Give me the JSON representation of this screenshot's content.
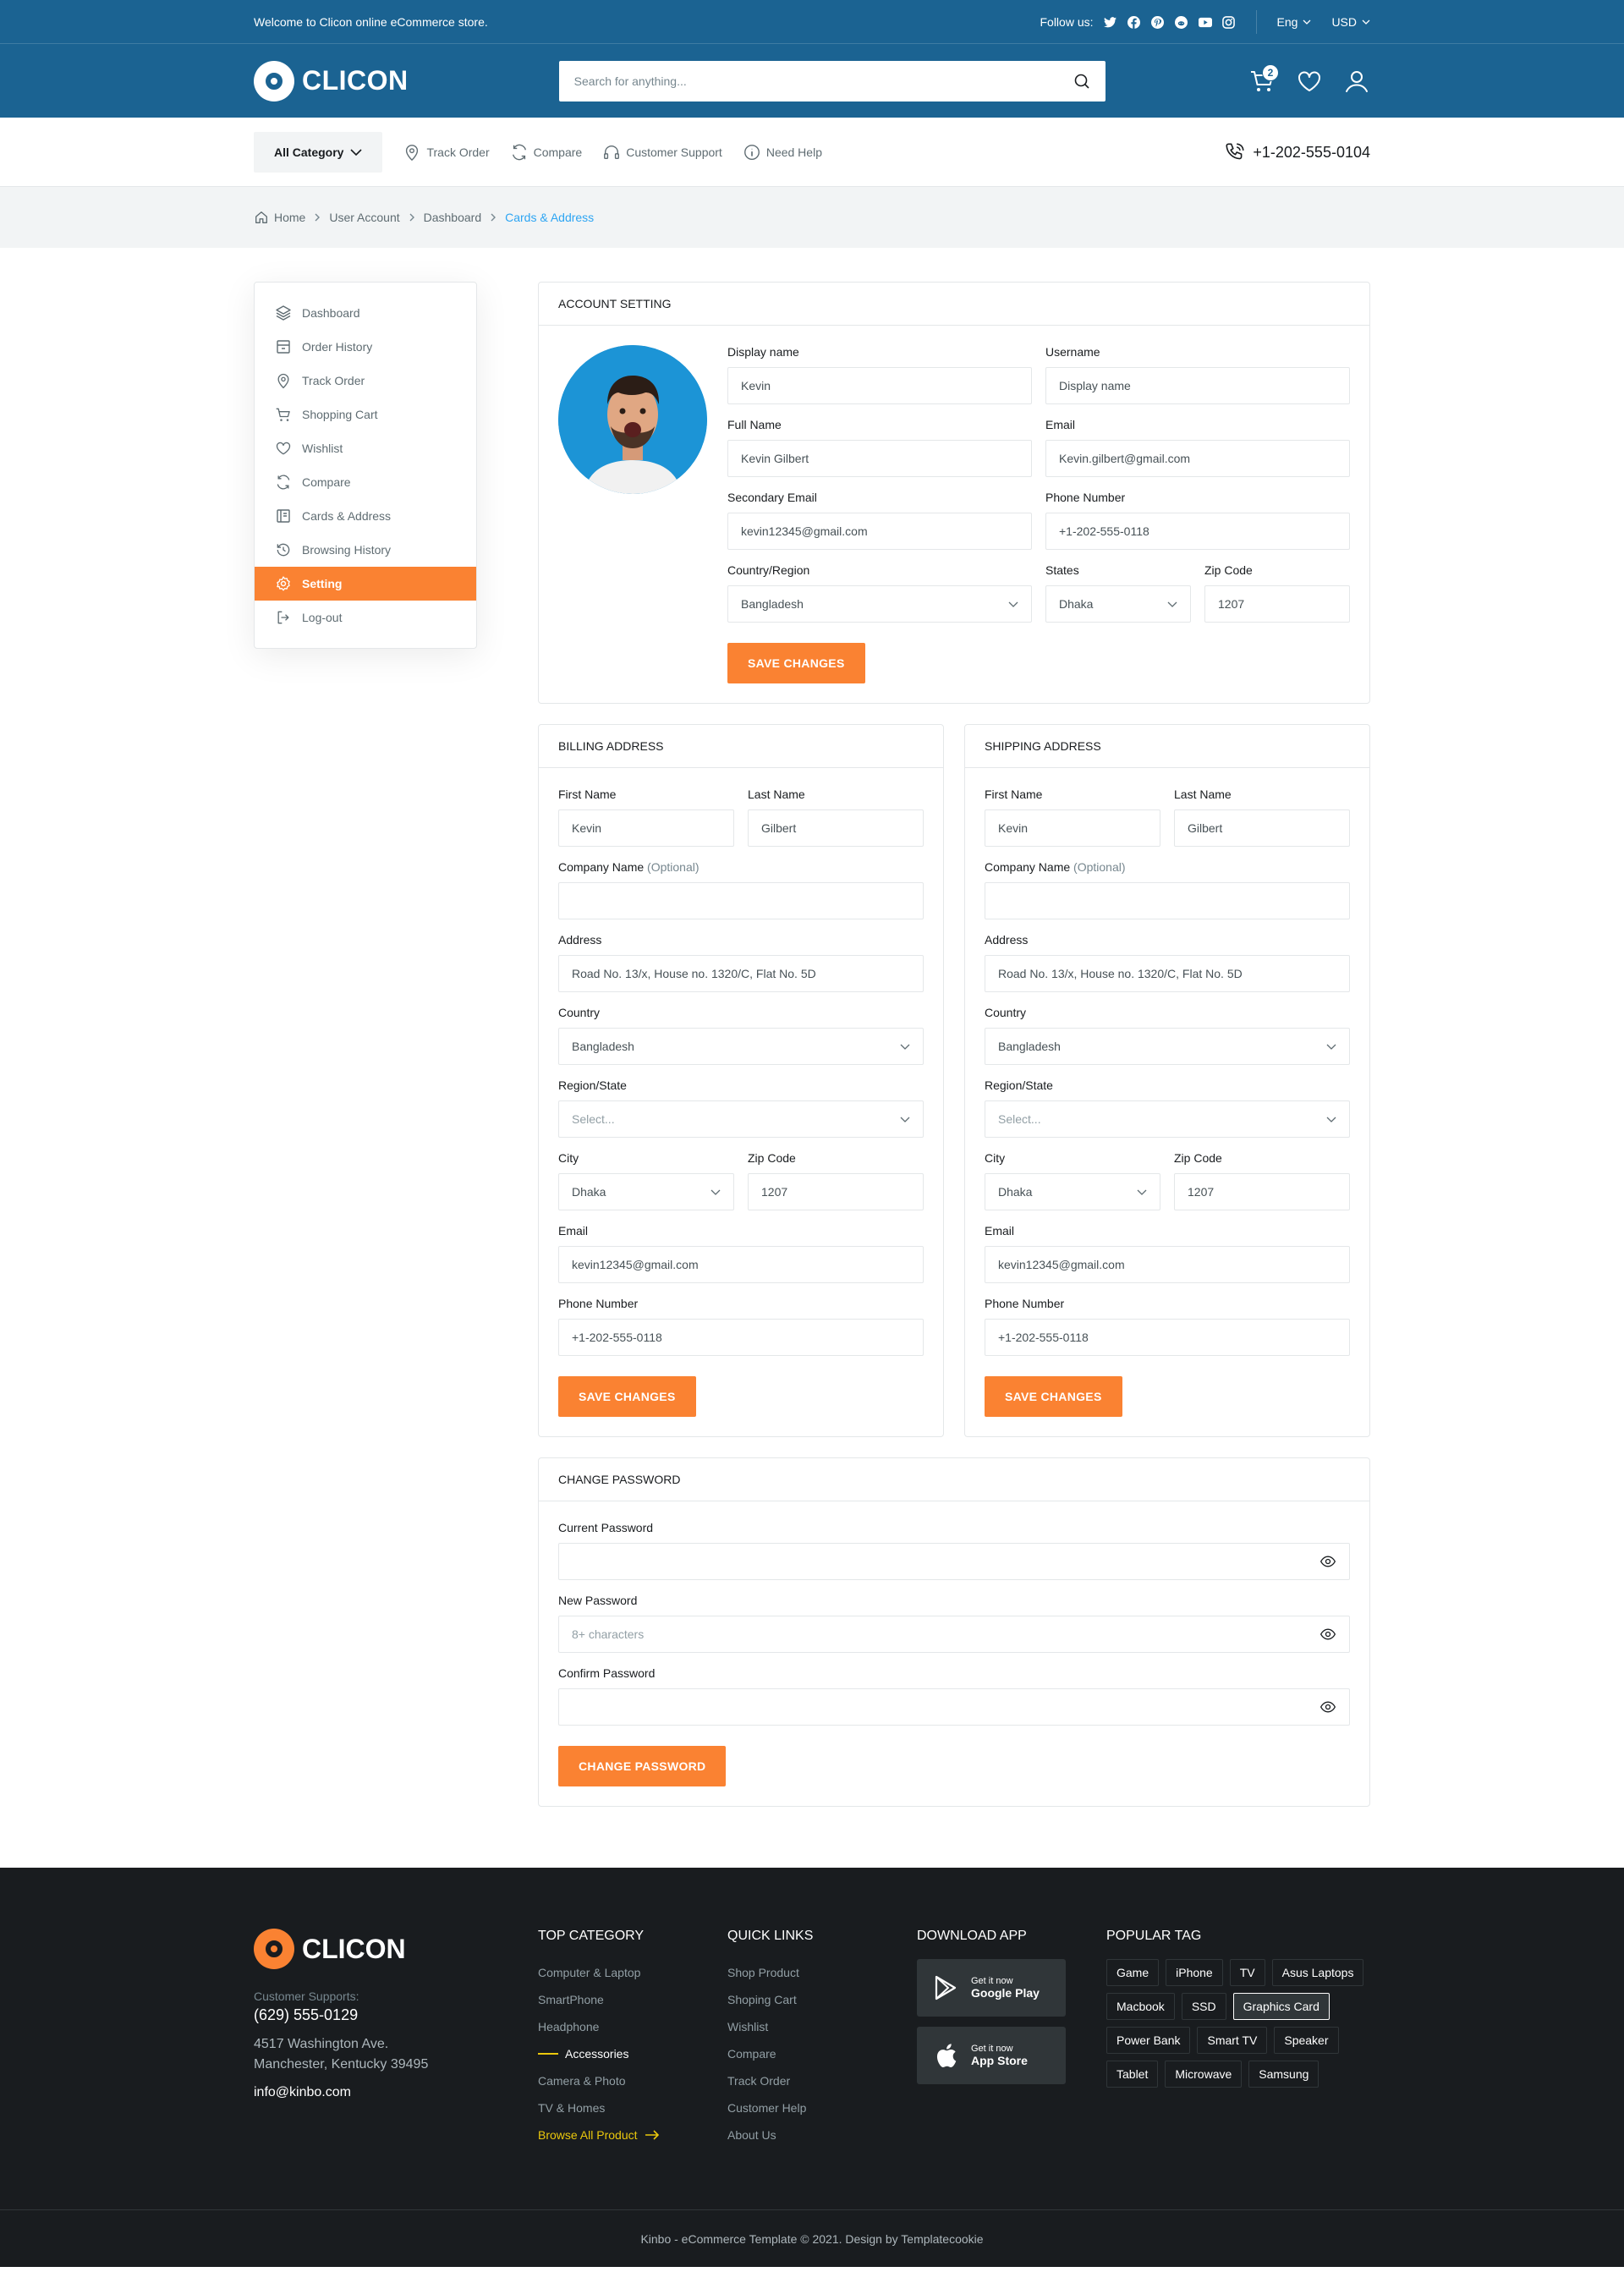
{
  "topbar": {
    "welcome": "Welcome to Clicon online eCommerce store.",
    "follow": "Follow us:",
    "lang": "Eng",
    "currency": "USD"
  },
  "header": {
    "brand": "CLICON",
    "search_placeholder": "Search for anything...",
    "cart_count": "2"
  },
  "nav": {
    "all_category": "All Category",
    "links": [
      "Track Order",
      "Compare",
      "Customer Support",
      "Need Help"
    ],
    "phone": "+1-202-555-0104"
  },
  "breadcrumb": [
    "Home",
    "User Account",
    "Dashboard",
    "Cards & Address"
  ],
  "sidebar": [
    "Dashboard",
    "Order History",
    "Track Order",
    "Shopping Cart",
    "Wishlist",
    "Compare",
    "Cards & Address",
    "Browsing History",
    "Setting",
    "Log-out"
  ],
  "account": {
    "title": "ACCOUNT SETTING",
    "display_name_label": "Display name",
    "display_name": "Kevin",
    "username_label": "Username",
    "username_placeholder": "Display name",
    "full_name_label": "Full Name",
    "full_name": "Kevin Gilbert",
    "email_label": "Email",
    "email": "Kevin.gilbert@gmail.com",
    "sec_email_label": "Secondary Email",
    "sec_email": "kevin12345@gmail.com",
    "phone_label": "Phone Number",
    "phone": "+1-202-555-0118",
    "country_label": "Country/Region",
    "country": "Bangladesh",
    "states_label": "States",
    "state": "Dhaka",
    "zip_label": "Zip Code",
    "zip": "1207",
    "save": "SAVE CHANGES"
  },
  "billing": {
    "title": "BILLING ADDRESS",
    "first_label": "First Name",
    "first": "Kevin",
    "last_label": "Last Name",
    "last": "Gilbert",
    "company_label": "Company Name",
    "optional": "(Optional)",
    "address_label": "Address",
    "address": "Road No. 13/x, House no. 1320/C, Flat No. 5D",
    "country_label": "Country",
    "country": "Bangladesh",
    "region_label": "Region/State",
    "region_placeholder": "Select...",
    "city_label": "City",
    "city": "Dhaka",
    "zip_label": "Zip Code",
    "zip": "1207",
    "email_label": "Email",
    "email": "kevin12345@gmail.com",
    "phone_label": "Phone Number",
    "phone": "+1-202-555-0118",
    "save": "SAVE CHANGES"
  },
  "shipping": {
    "title": "SHIPPING ADDRESS",
    "first_label": "First Name",
    "first": "Kevin",
    "last_label": "Last Name",
    "last": "Gilbert",
    "company_label": "Company Name",
    "optional": "(Optional)",
    "address_label": "Address",
    "address": "Road No. 13/x, House no. 1320/C, Flat No. 5D",
    "country_label": "Country",
    "country": "Bangladesh",
    "region_label": "Region/State",
    "region_placeholder": "Select...",
    "city_label": "City",
    "city": "Dhaka",
    "zip_label": "Zip Code",
    "zip": "1207",
    "email_label": "Email",
    "email": "kevin12345@gmail.com",
    "phone_label": "Phone Number",
    "phone": "+1-202-555-0118",
    "save": "SAVE CHANGES"
  },
  "password": {
    "title": "CHANGE PASSWORD",
    "current_label": "Current Password",
    "new_label": "New Password",
    "new_placeholder": "8+ characters",
    "confirm_label": "Confirm Password",
    "submit": "CHANGE PASSWORD"
  },
  "footer": {
    "brand": "CLICON",
    "support_label": "Customer Supports:",
    "phone": "(629) 555-0129",
    "address": "4517 Washington Ave. Manchester, Kentucky 39495",
    "email": "info@kinbo.com",
    "top_category_title": "TOP CATEGORY",
    "top_category": [
      "Computer & Laptop",
      "SmartPhone",
      "Headphone",
      "Accessories",
      "Camera & Photo",
      "TV & Homes"
    ],
    "browse_all": "Browse All Product",
    "quick_links_title": "QUICK LINKS",
    "quick_links": [
      "Shop Product",
      "Shoping Cart",
      "Wishlist",
      "Compare",
      "Track Order",
      "Customer Help",
      "About Us"
    ],
    "download_title": "DOWNLOAD APP",
    "apps": [
      {
        "small": "Get it now",
        "name": "Google Play"
      },
      {
        "small": "Get it now",
        "name": "App Store"
      }
    ],
    "tags_title": "POPULAR TAG",
    "tags": [
      "Game",
      "iPhone",
      "TV",
      "Asus Laptops",
      "Macbook",
      "SSD",
      "Graphics Card",
      "Power Bank",
      "Smart TV",
      "Speaker",
      "Tablet",
      "Microwave",
      "Samsung"
    ],
    "copyright": "Kinbo - eCommerce Template © 2021. Design by Templatecookie"
  },
  "colors": {
    "primary": "#1b6392",
    "accent": "#fa8232",
    "link": "#2da5f3",
    "footer_bg": "#191c1f",
    "highlight": "#ebc80c"
  }
}
